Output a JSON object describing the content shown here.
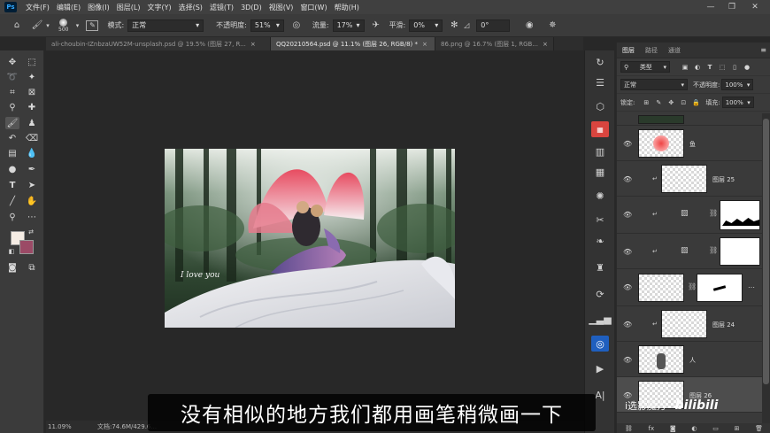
{
  "app": {
    "logo": "Ps",
    "menu": [
      "文件(F)",
      "编辑(E)",
      "图像(I)",
      "图层(L)",
      "文字(Y)",
      "选择(S)",
      "滤镜(T)",
      "3D(D)",
      "视图(V)",
      "窗口(W)",
      "帮助(H)"
    ],
    "window_controls": [
      "—",
      "❐",
      "✕"
    ]
  },
  "options_bar": {
    "brush_size": "500",
    "mode_label": "模式:",
    "mode_value": "正常",
    "opacity_label": "不透明度:",
    "opacity_value": "51%",
    "flow_label": "流量:",
    "flow_value": "17%",
    "smoothing_label": "平滑:",
    "smoothing_value": "0%",
    "angle_value": "0°"
  },
  "tabs": [
    {
      "label": "ali-choubin-IZnbzaUW52M-unsplash.psd @ 19.5% (图层 27, R...",
      "close": "×"
    },
    {
      "label": "QQ20210564.psd @ 11.1% (图层 26, RGB/8) *",
      "close": "×"
    },
    {
      "label": "86.png @ 16.7% (图层 1, RGB...",
      "close": "×"
    }
  ],
  "canvas": {
    "script_text": "I love you"
  },
  "status": {
    "zoom": "11.09%",
    "doc_size": "文档:74.6M/429.6..."
  },
  "panels": {
    "tabs": [
      "图层",
      "路径",
      "通道"
    ],
    "filter_label": "类型",
    "blend_mode": "正常",
    "opacity_label": "不透明度:",
    "opacity_value": "100%",
    "lock_label": "锁定:",
    "fill_label": "填充:",
    "fill_value": "100%",
    "layers": [
      {
        "name": ""
      },
      {
        "name": "鱼"
      },
      {
        "name": "图层 25"
      },
      {
        "name": ""
      },
      {
        "name": ""
      },
      {
        "name": ""
      },
      {
        "name": "图层 24"
      },
      {
        "name": "人"
      },
      {
        "name": "图层 26"
      }
    ],
    "bottom_icons": [
      "fx"
    ]
  },
  "overlay": {
    "subtitle": "没有相似的地方我们都用画笔稍微画一下",
    "watermark_text": "i选影魔方",
    "watermark_logo": "bilibili"
  },
  "colors": {
    "foreground": "#f5ece4",
    "background": "#9b4a66",
    "accent_red": "#d9453f",
    "accent_blue": "#1f5fbf"
  }
}
